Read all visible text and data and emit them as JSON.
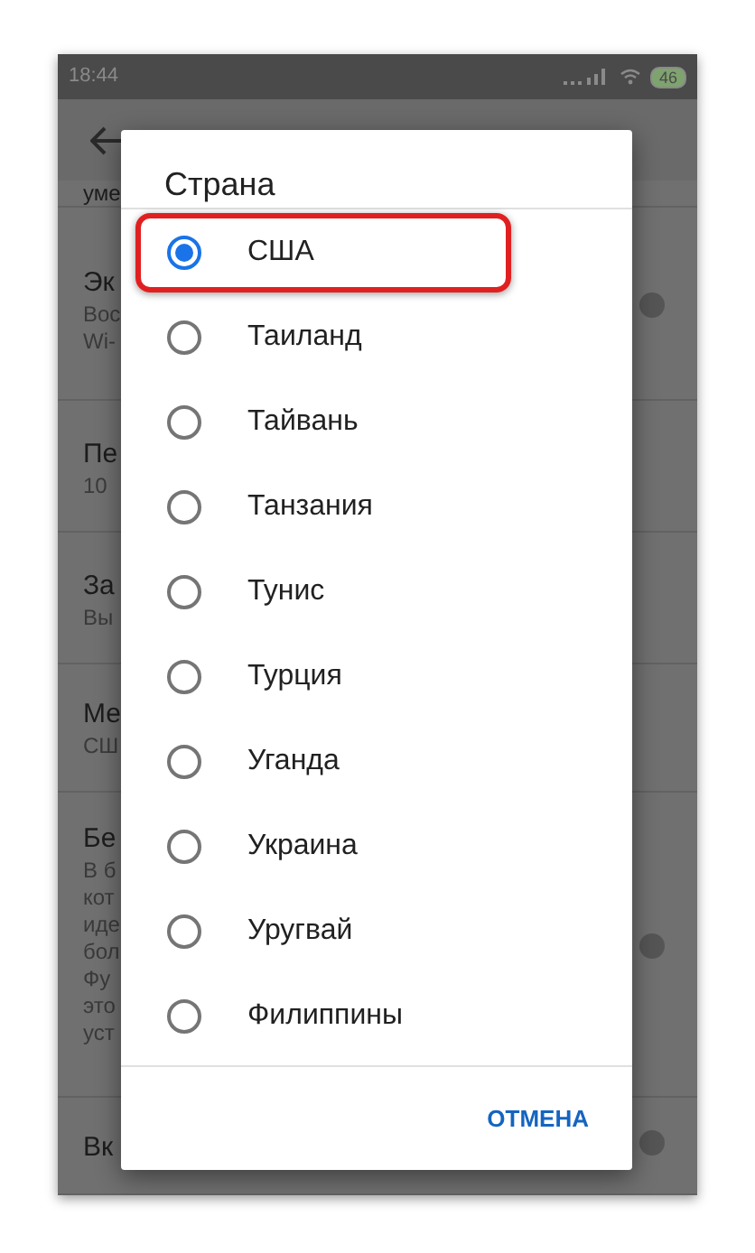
{
  "status_bar": {
    "time": "18:44",
    "battery": "46"
  },
  "background_settings": [
    {
      "lines": [
        "уме"
      ],
      "switch": false
    },
    {
      "lines": [
        "Эк",
        "Вос",
        "Wi-"
      ],
      "switch": true
    },
    {
      "lines": [
        "Пе",
        "10"
      ],
      "switch": false
    },
    {
      "lines": [
        "За",
        "Вы"
      ],
      "switch": false
    },
    {
      "lines": [
        "Ме",
        "СШ"
      ],
      "switch": false
    },
    {
      "lines": [
        "Бе",
        "В б",
        "кот",
        "иде",
        "бол",
        "Фу",
        "это",
        "уст"
      ],
      "switch": true
    },
    {
      "lines": [
        "Вк"
      ],
      "switch": true
    }
  ],
  "dialog": {
    "title": "Страна",
    "options": [
      {
        "label": "США",
        "selected": true
      },
      {
        "label": "Таиланд",
        "selected": false
      },
      {
        "label": "Тайвань",
        "selected": false
      },
      {
        "label": "Танзания",
        "selected": false
      },
      {
        "label": "Тунис",
        "selected": false
      },
      {
        "label": "Турция",
        "selected": false
      },
      {
        "label": "Уганда",
        "selected": false
      },
      {
        "label": "Украина",
        "selected": false
      },
      {
        "label": "Уругвай",
        "selected": false
      },
      {
        "label": "Филиппины",
        "selected": false
      }
    ],
    "cancel_button": "ОТМЕНА"
  }
}
